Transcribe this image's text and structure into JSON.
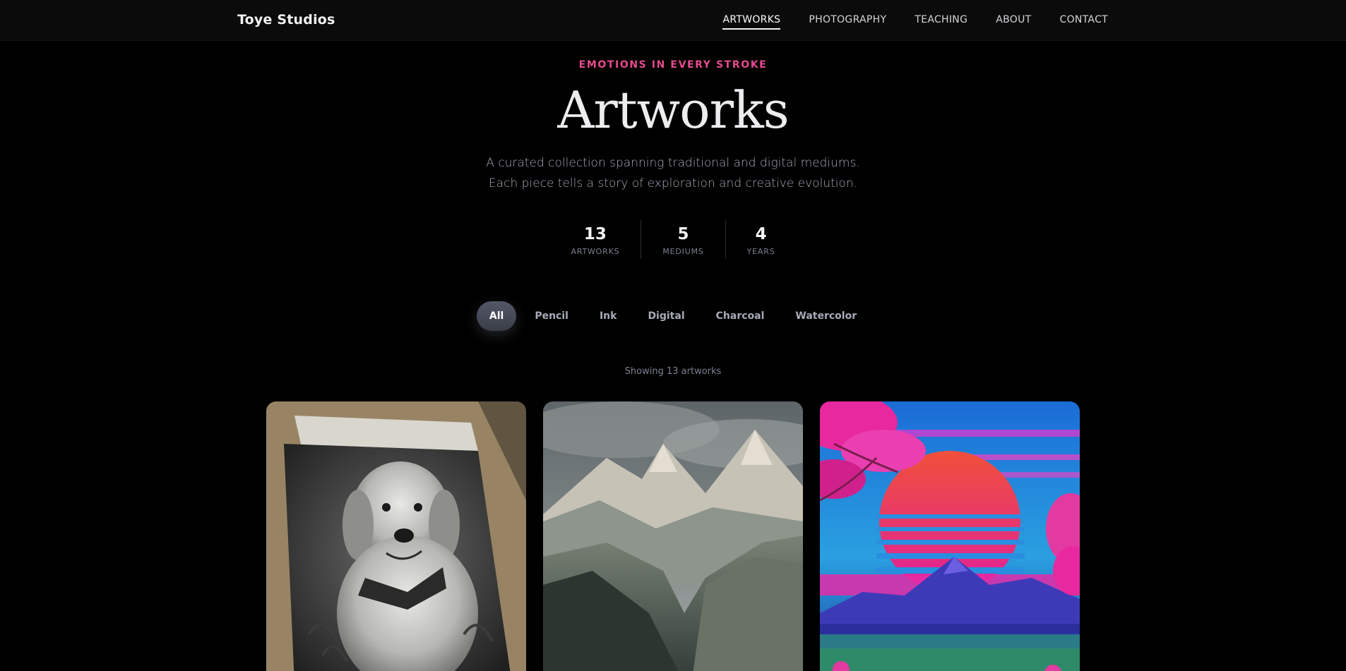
{
  "brand": "Toye Studios",
  "nav": [
    {
      "label": "ARTWORKS",
      "active": true
    },
    {
      "label": "PHOTOGRAPHY",
      "active": false
    },
    {
      "label": "TEACHING",
      "active": false
    },
    {
      "label": "ABOUT",
      "active": false
    },
    {
      "label": "CONTACT",
      "active": false
    }
  ],
  "hero": {
    "eyebrow": "EMOTIONS IN EVERY STROKE",
    "title": "Artworks",
    "subtitle_line1": "A curated collection spanning traditional and digital mediums.",
    "subtitle_line2": "Each piece tells a story of exploration and creative evolution."
  },
  "stats": [
    {
      "value": "13",
      "label": "ARTWORKS"
    },
    {
      "value": "5",
      "label": "MEDIUMS"
    },
    {
      "value": "4",
      "label": "YEARS"
    }
  ],
  "filters": [
    "All",
    "Pencil",
    "Ink",
    "Digital",
    "Charcoal",
    "Watercolor"
  ],
  "active_filter": "All",
  "showing_text": "Showing 13 artworks",
  "colors": {
    "accent": "#e64a8f",
    "background": "#000000",
    "nav_background": "#0b0b0c"
  }
}
